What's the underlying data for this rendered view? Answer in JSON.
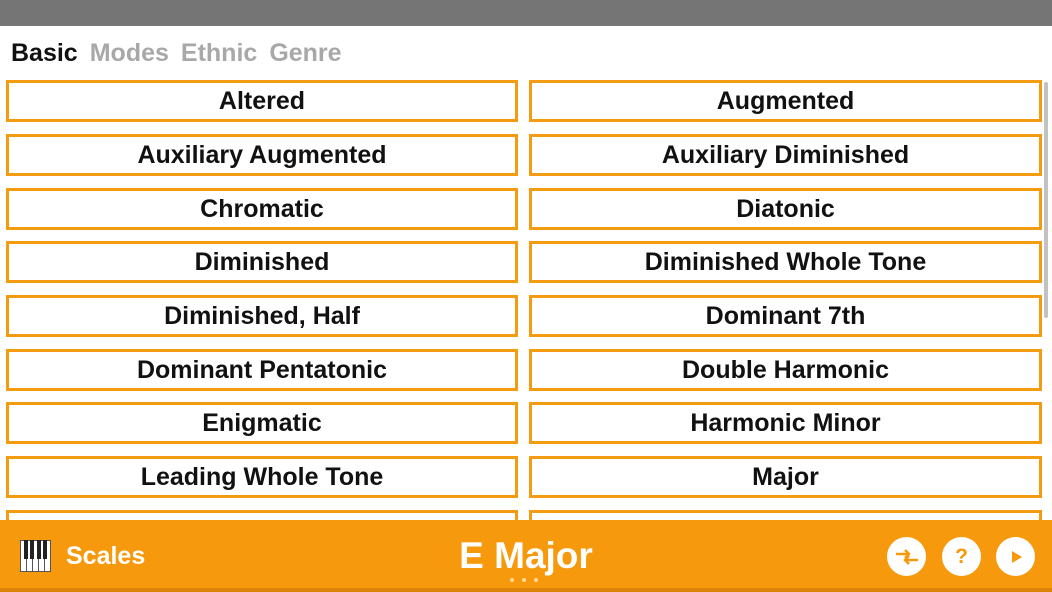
{
  "tabs": [
    {
      "label": "Basic",
      "active": true
    },
    {
      "label": "Modes",
      "active": false
    },
    {
      "label": "Ethnic",
      "active": false
    },
    {
      "label": "Genre",
      "active": false
    }
  ],
  "scales": [
    [
      "Altered",
      "Augmented"
    ],
    [
      "Auxiliary Augmented",
      "Auxiliary Diminished"
    ],
    [
      "Chromatic",
      "Diatonic"
    ],
    [
      "Diminished",
      "Diminished Whole Tone"
    ],
    [
      "Diminished, Half",
      "Dominant 7th"
    ],
    [
      "Dominant Pentatonic",
      "Double Harmonic"
    ],
    [
      "Enigmatic",
      "Harmonic Minor"
    ],
    [
      "Leading Whole Tone",
      "Major"
    ]
  ],
  "bottom_bar": {
    "app_label": "Scales",
    "title": "E Major",
    "help_glyph": "?"
  },
  "icons": {
    "app": "piano-icon",
    "swap": "swap-arrows-icon",
    "help": "question-mark-icon",
    "play": "play-icon"
  },
  "colors": {
    "accent": "#f7990c",
    "border": "#f39c12",
    "statusbar": "#757575",
    "tab_inactive": "#a8a8a8",
    "text": "#111111"
  }
}
